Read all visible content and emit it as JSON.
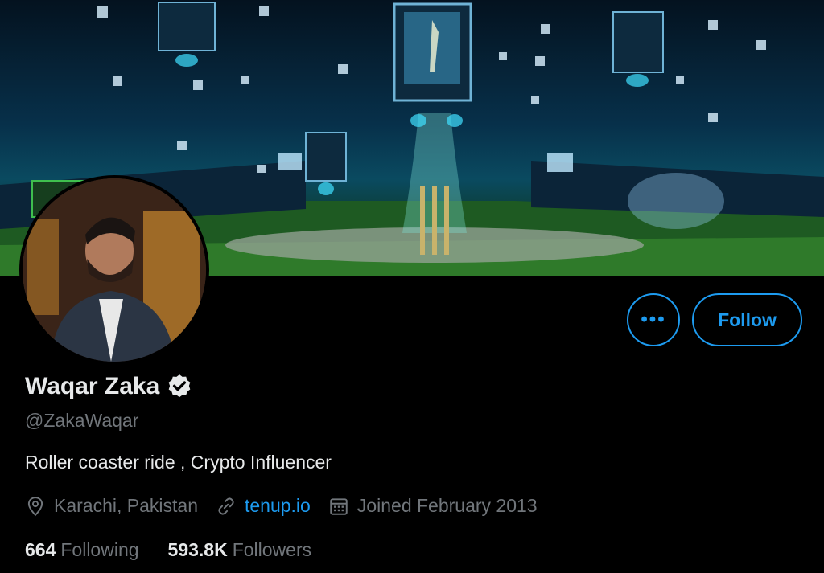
{
  "profile": {
    "name": "Waqar Zaka",
    "handle": "@ZakaWaqar",
    "bio": "Roller coaster ride , Crypto Influencer",
    "location": "Karachi, Pakistan",
    "website": "tenup.io",
    "joined": "Joined February 2013"
  },
  "actions": {
    "more_label": "•••",
    "follow_label": "Follow"
  },
  "stats": {
    "following_count": "664",
    "following_label": "Following",
    "followers_count": "593.8K",
    "followers_label": "Followers"
  },
  "icons": {
    "verified": "verified-badge-icon",
    "location": "location-pin-icon",
    "link": "link-icon",
    "calendar": "calendar-icon"
  },
  "colors": {
    "accent": "#1d9bf0",
    "background": "#000000",
    "secondary_text": "#71767b",
    "primary_text": "#e7e9ea"
  }
}
